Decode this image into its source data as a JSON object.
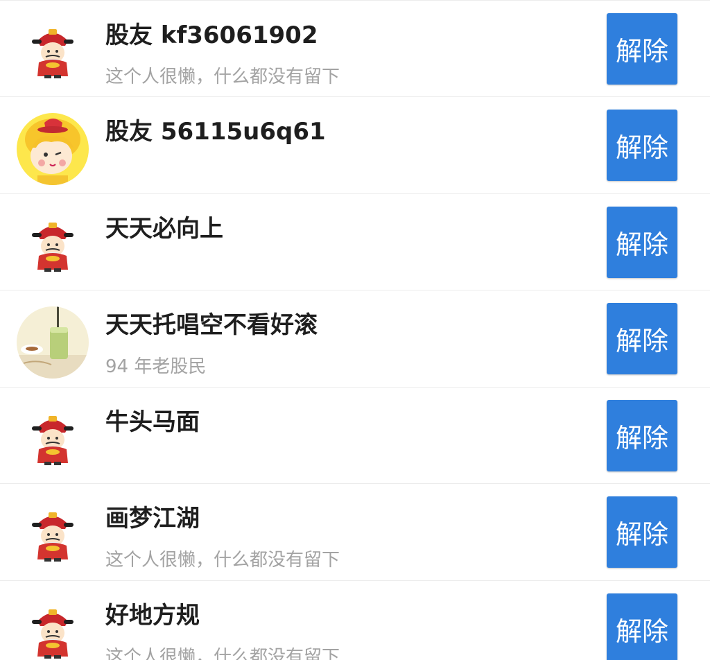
{
  "friends": [
    {
      "name": "股友 kf36061902",
      "signature": "这个人很懒，什么都没有留下",
      "avatar": "fortune-god-icon",
      "button": "解除"
    },
    {
      "name": "股友 56115u6q61",
      "signature": "",
      "avatar": "cartoon-girl-avatar",
      "button": "解除"
    },
    {
      "name": "天天必向上",
      "signature": "",
      "avatar": "fortune-god-icon",
      "button": "解除"
    },
    {
      "name": "天天托唱空不看好滚",
      "signature": "94 年老股民",
      "avatar": "matcha-drink-photo",
      "button": "解除"
    },
    {
      "name": "牛头马面",
      "signature": "",
      "avatar": "fortune-god-icon",
      "button": "解除"
    },
    {
      "name": "画梦江湖",
      "signature": "这个人很懒，什么都没有留下",
      "avatar": "fortune-god-icon",
      "button": "解除"
    },
    {
      "name": "好地方规",
      "signature": "这个人很懒，什么都没有留下",
      "avatar": "fortune-god-icon",
      "button": "解除"
    }
  ],
  "colors": {
    "button": "#2f7fdd",
    "name": "#1e1e1e",
    "signature": "#a3a3a3",
    "divider": "#ececec"
  }
}
